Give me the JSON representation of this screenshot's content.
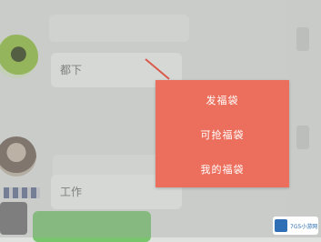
{
  "chat": {
    "message_1": "都下",
    "message_2": "工作"
  },
  "popup": {
    "items": [
      {
        "label": "发福袋"
      },
      {
        "label": "可抢福袋"
      },
      {
        "label": "我的福袋"
      }
    ],
    "background": "#ec6f5d",
    "text_color": "#ffffff"
  },
  "watermark": {
    "text": "7G5小游网"
  }
}
